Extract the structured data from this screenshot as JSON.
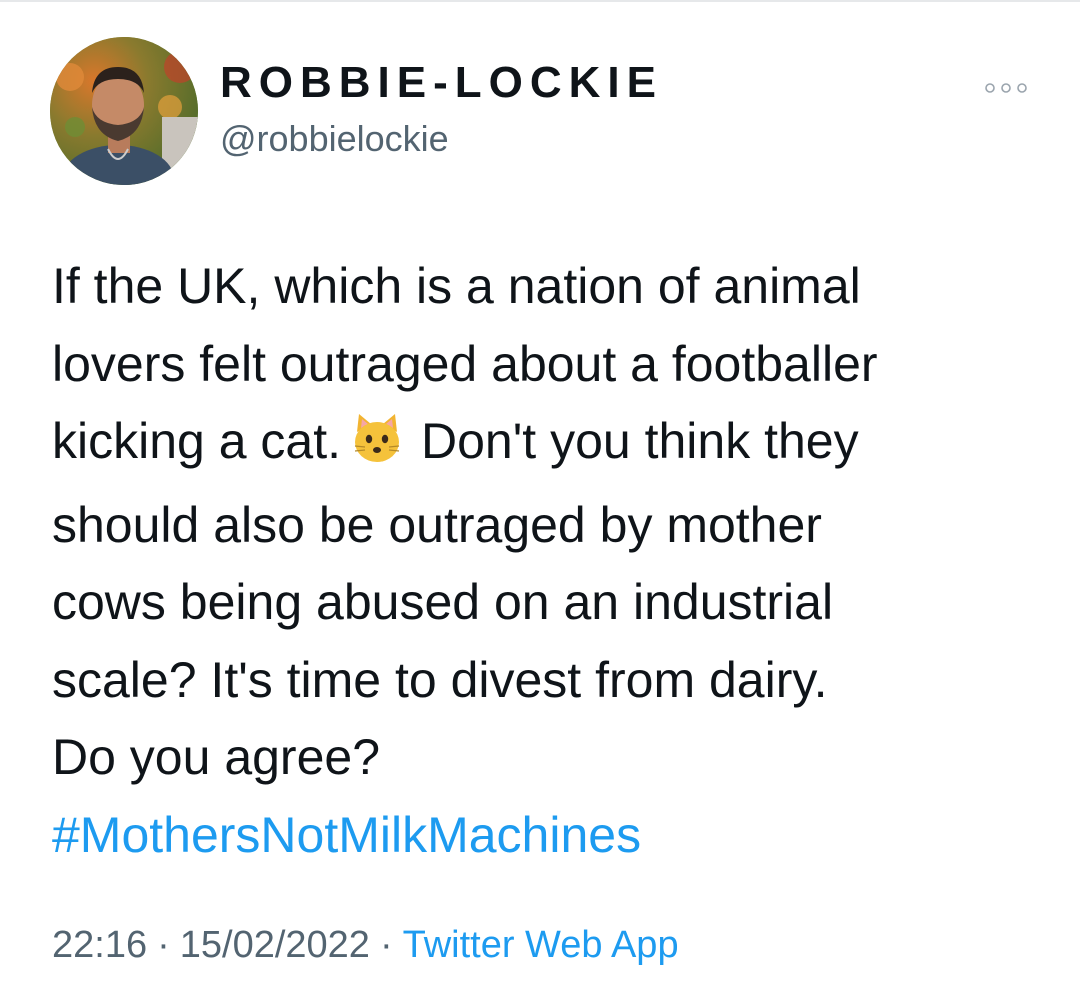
{
  "author": {
    "display_name": "ROBBIE-LOCKIE",
    "handle": "@robbielockie",
    "avatar_icon": "profile-photo"
  },
  "menu": {
    "more_icon": "more-horizontal-icon"
  },
  "tweet": {
    "lines": [
      "If the UK, which is a nation of animal",
      "lovers felt outraged about a footballer",
      "kicking a cat.",
      "Don't you think they",
      "should also be outraged by mother",
      "cows being abused on an industrial",
      "scale? It's time to divest from dairy.",
      "Do you agree?"
    ],
    "emoji": "cat-face-icon",
    "hashtag": "#MothersNotMilkMachines"
  },
  "meta": {
    "time": "22:16",
    "separator": "·",
    "date": "15/02/2022",
    "source": "Twitter Web App"
  },
  "colors": {
    "text": "#0f1419",
    "secondary": "#536471",
    "link": "#1d9bf0"
  }
}
